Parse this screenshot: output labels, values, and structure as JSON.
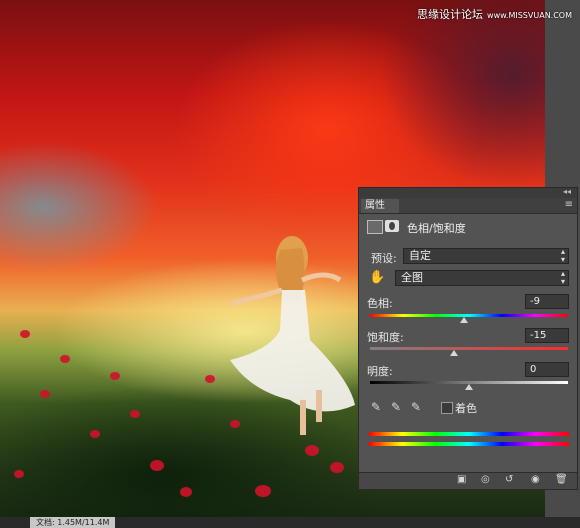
{
  "watermark": {
    "text": "思缘设计论坛",
    "site": "www.MISSVUAN.COM"
  },
  "panel": {
    "tab_label": "属性",
    "title": "色相/饱和度",
    "preset_label": "预设:",
    "preset_value": "自定",
    "channel_value": "全图",
    "hue_label": "色相:",
    "hue_value": "-9",
    "saturation_label": "饱和度:",
    "saturation_value": "-15",
    "lightness_label": "明度:",
    "lightness_value": "0",
    "colorize_label": "着色",
    "hue_level": -9,
    "saturation_level": -15,
    "lightness_level": 0
  },
  "icons": {
    "collapse": "double-chevron-right-icon",
    "menu": "panel-menu-icon",
    "adjustment": "adjustment-layer-icon",
    "mask": "layer-mask-icon",
    "hand": "targeted-adjustment-hand-icon",
    "eyedropper": "eyedropper-icon",
    "eyedropper_plus": "eyedropper-plus-icon",
    "eyedropper_minus": "eyedropper-minus-icon",
    "clip": "clip-to-layer-icon",
    "view_previous": "view-previous-icon",
    "reset": "reset-icon",
    "visibility": "eye-icon",
    "delete": "trash-icon"
  },
  "status": {
    "text": "文档: 1.45M/11.4M"
  },
  "colors": {
    "panel_bg": "#535353",
    "field_bg": "#3a3a3a"
  }
}
